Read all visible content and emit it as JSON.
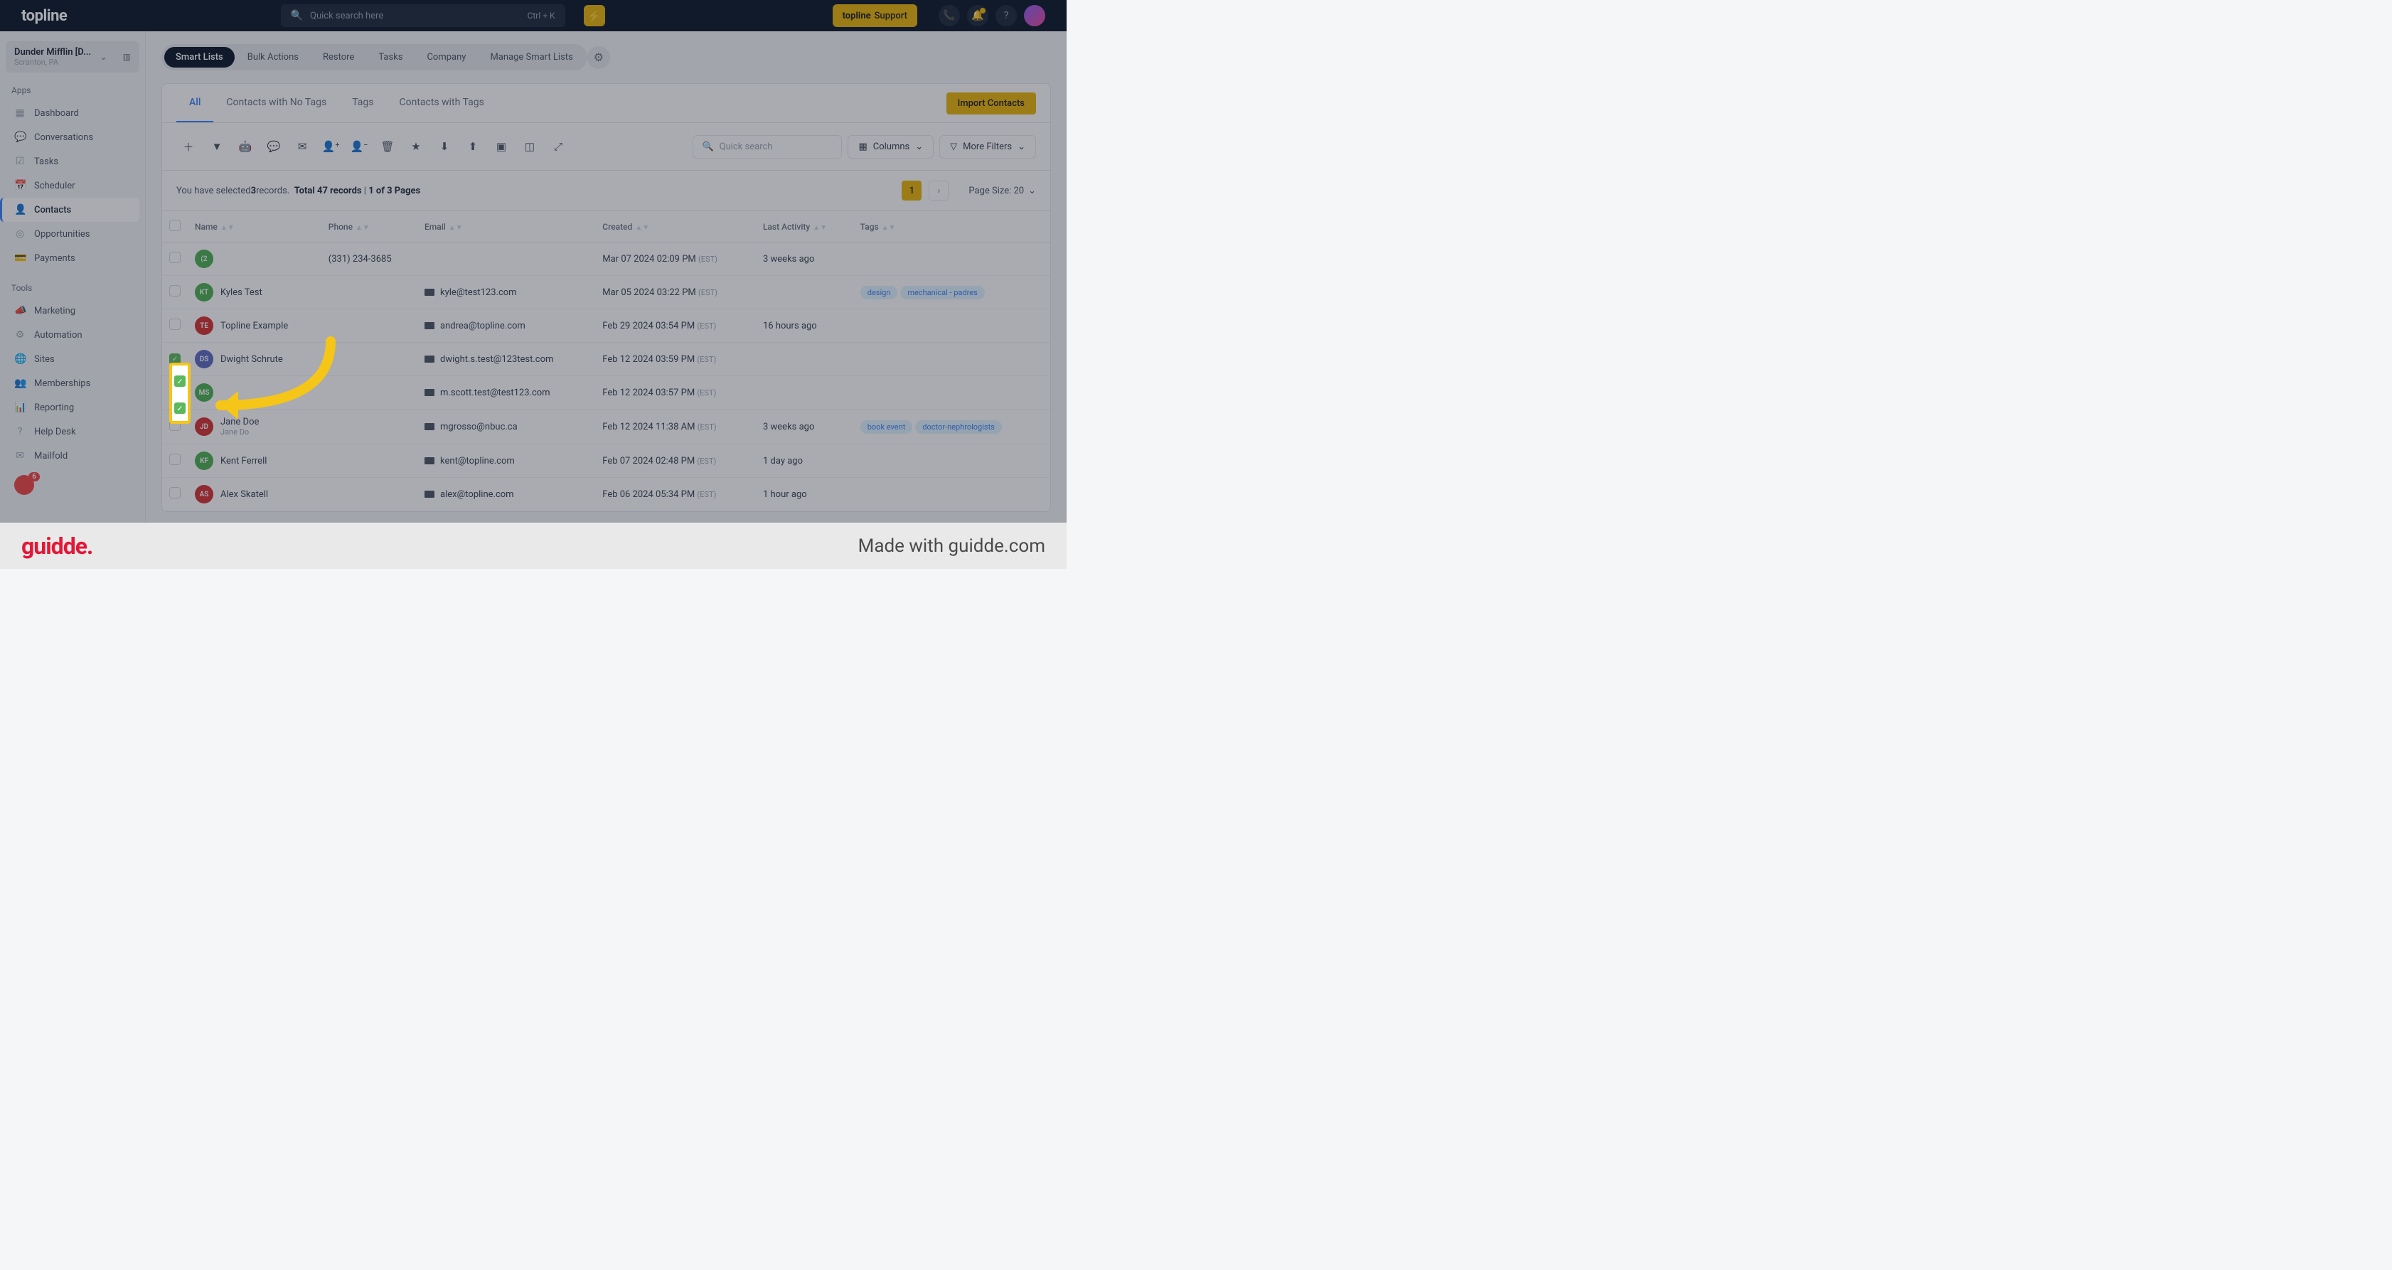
{
  "header": {
    "logo": "topline",
    "search_placeholder": "Quick search here",
    "search_shortcut": "Ctrl + K",
    "support_logo": "topline",
    "support_label": "Support"
  },
  "account": {
    "name": "Dunder Mifflin [D...",
    "location": "Scranton, PA"
  },
  "sidebar": {
    "sections": [
      {
        "title": "Apps",
        "items": [
          {
            "icon": "▦",
            "label": "Dashboard"
          },
          {
            "icon": "💬",
            "label": "Conversations"
          },
          {
            "icon": "☑",
            "label": "Tasks"
          },
          {
            "icon": "📅",
            "label": "Scheduler"
          },
          {
            "icon": "👤",
            "label": "Contacts",
            "active": true
          },
          {
            "icon": "◎",
            "label": "Opportunities"
          },
          {
            "icon": "💳",
            "label": "Payments"
          }
        ]
      },
      {
        "title": "Tools",
        "items": [
          {
            "icon": "📣",
            "label": "Marketing"
          },
          {
            "icon": "⚙",
            "label": "Automation"
          },
          {
            "icon": "🌐",
            "label": "Sites"
          },
          {
            "icon": "👥",
            "label": "Memberships"
          },
          {
            "icon": "📊",
            "label": "Reporting"
          },
          {
            "icon": "?",
            "label": "Help Desk"
          },
          {
            "icon": "✉",
            "label": "Mailfold"
          }
        ]
      }
    ],
    "badge_count": "6"
  },
  "main_tabs": [
    "Smart Lists",
    "Bulk Actions",
    "Restore",
    "Tasks",
    "Company",
    "Manage Smart Lists"
  ],
  "sub_tabs": [
    "All",
    "Contacts with No Tags",
    "Tags",
    "Contacts with Tags"
  ],
  "import_label": "Import Contacts",
  "quick_search_placeholder": "Quick search",
  "columns_label": "Columns",
  "filters_label": "More Filters",
  "selection": {
    "prefix": "You have selected ",
    "count": "3",
    "suffix": " records.",
    "total": "Total 47 records",
    "pages": "1 of 3 Pages"
  },
  "pagination": {
    "page": "1",
    "size_label": "Page Size: 20"
  },
  "columns": [
    "Name",
    "Phone",
    "Email",
    "Created",
    "Last Activity",
    "Tags"
  ],
  "rows": [
    {
      "checked": false,
      "avatar": "(2",
      "color": "#4caf50",
      "name": "",
      "phone": "(331) 234-3685",
      "email": "",
      "created": "Mar 07 2024 02:09 PM",
      "tz": "(EST)",
      "activity": "3 weeks ago",
      "tags": []
    },
    {
      "checked": false,
      "avatar": "KT",
      "color": "#4caf50",
      "name": "Kyles Test",
      "phone": "",
      "email": "kyle@test123.com",
      "created": "Mar 05 2024 03:22 PM",
      "tz": "(EST)",
      "activity": "",
      "tags": [
        {
          "t": "design",
          "c": "blue"
        },
        {
          "t": "mechanical - padres",
          "c": "blue"
        }
      ]
    },
    {
      "checked": false,
      "avatar": "TE",
      "color": "#d32f2f",
      "name": "Topline Example",
      "phone": "",
      "email": "andrea@topline.com",
      "created": "Feb 29 2024 03:54 PM",
      "tz": "(EST)",
      "activity": "16 hours ago",
      "tags": []
    },
    {
      "checked": true,
      "avatar": "DS",
      "color": "#5c6bc0",
      "name": "Dwight Schrute",
      "phone": "",
      "email": "dwight.s.test@123test.com",
      "created": "Feb 12 2024 03:59 PM",
      "tz": "(EST)",
      "activity": "",
      "tags": []
    },
    {
      "checked": true,
      "avatar": "MS",
      "color": "#4caf50",
      "name": "",
      "phone": "",
      "email": "m.scott.test@test123.com",
      "created": "Feb 12 2024 03:57 PM",
      "tz": "(EST)",
      "activity": "",
      "tags": []
    },
    {
      "checked": false,
      "avatar": "JD",
      "color": "#d32f2f",
      "name": "Jane Doe",
      "sub": "Jane Do",
      "phone": "",
      "email": "mgrosso@nbuc.ca",
      "created": "Feb 12 2024 11:38 AM",
      "tz": "(EST)",
      "activity": "3 weeks ago",
      "tags": [
        {
          "t": "book event",
          "c": "blue"
        },
        {
          "t": "doctor-nephrologists",
          "c": "blue"
        }
      ]
    },
    {
      "checked": false,
      "avatar": "KF",
      "color": "#4caf50",
      "name": "Kent Ferrell",
      "phone": "",
      "email": "kent@topline.com",
      "created": "Feb 07 2024 02:48 PM",
      "tz": "(EST)",
      "activity": "1 day ago",
      "tags": []
    },
    {
      "checked": false,
      "avatar": "AS",
      "color": "#d32f2f",
      "name": "Alex Skatell",
      "phone": "",
      "email": "alex@topline.com",
      "created": "Feb 06 2024 05:34 PM",
      "tz": "(EST)",
      "activity": "1 hour ago",
      "tags": []
    }
  ],
  "footer": {
    "logo": "guidde.",
    "made": "Made with guidde.com"
  }
}
